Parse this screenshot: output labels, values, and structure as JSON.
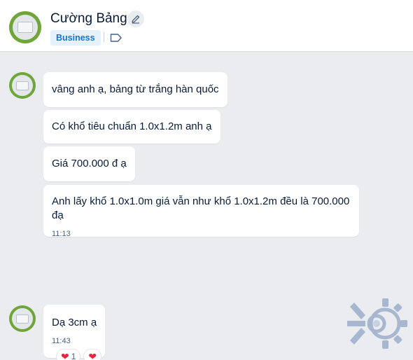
{
  "header": {
    "contact_name": "Cường Bảng",
    "badge": "Business",
    "edit_icon": "pencil-icon",
    "tag_icon": "label-tag-icon"
  },
  "messages": [
    {
      "text": "vâng anh ạ, bảng từ trắng hàn quốc",
      "time": ""
    },
    {
      "text": "Có khổ tiêu chuẩn 1.0x1.2m anh ạ",
      "time": ""
    },
    {
      "text": "Giá 700.000 đ ạ",
      "time": ""
    },
    {
      "text": "Anh lấy khổ 1.0x1.0m giá vẫn như khổ 1.0x1.2m đều là 700.000 đạ",
      "time": "11:13"
    },
    {
      "text": "Dạ 3cm ạ",
      "time": "11:43"
    }
  ],
  "reactions": {
    "heart_count": "1",
    "icon": "heart-icon"
  },
  "colors": {
    "background": "#ebecf0",
    "badge_text": "#1a73c7",
    "badge_bg": "#e5f1fb",
    "avatar_green": "#6fa539",
    "heart": "#e5283d"
  }
}
